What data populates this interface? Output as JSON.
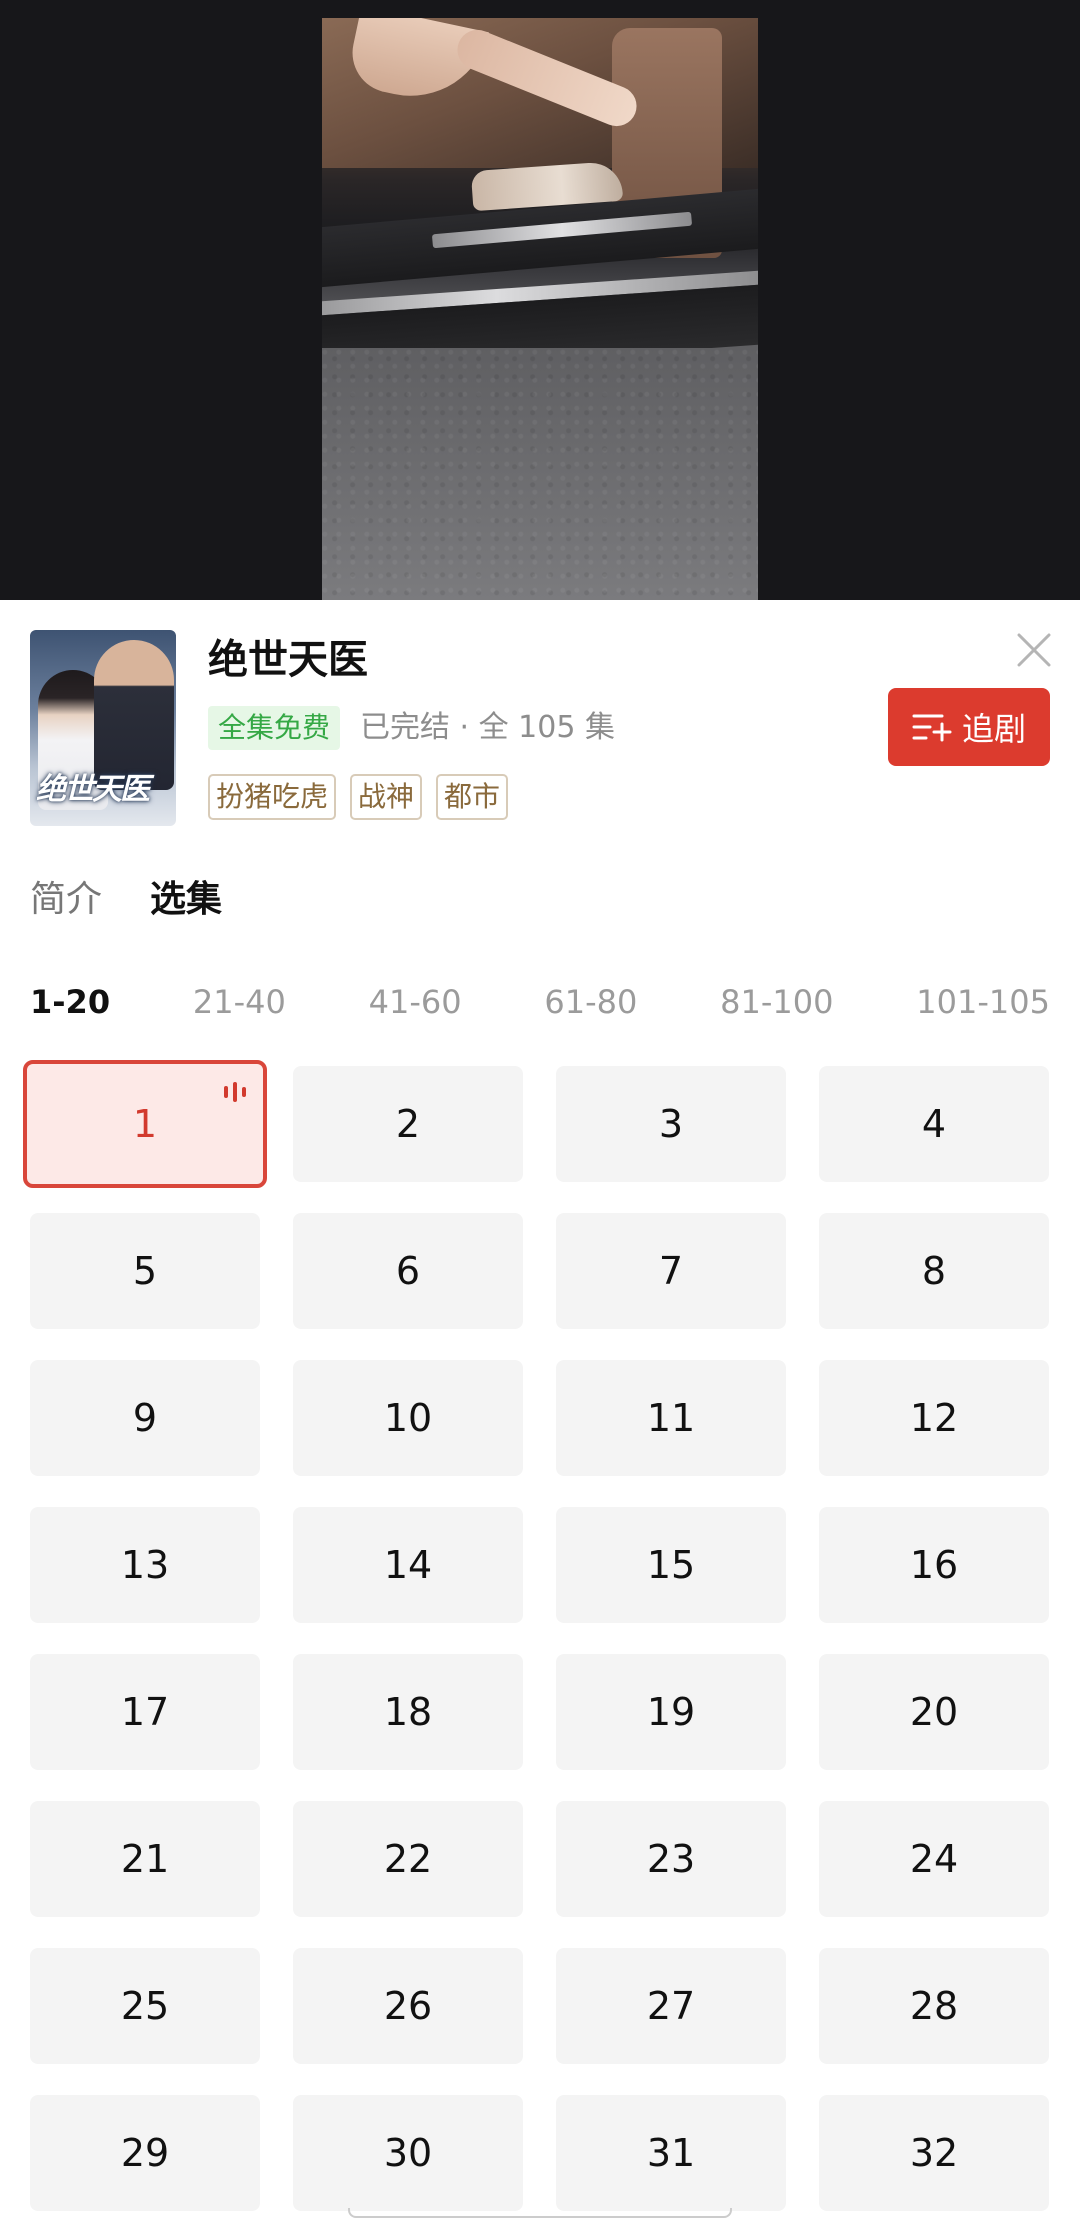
{
  "drama": {
    "poster_text": "绝世天医",
    "title": "绝世天医",
    "free_badge": "全集免费",
    "status": "已完结 · 全 105 集",
    "tags": [
      "扮猪吃虎",
      "战神",
      "都市"
    ],
    "follow_label": "追剧"
  },
  "section_tabs": [
    {
      "label": "简介",
      "active": false
    },
    {
      "label": "选集",
      "active": true
    }
  ],
  "range_tabs": [
    {
      "label": "1-20",
      "active": true
    },
    {
      "label": "21-40",
      "active": false
    },
    {
      "label": "41-60",
      "active": false
    },
    {
      "label": "61-80",
      "active": false
    },
    {
      "label": "81-100",
      "active": false
    },
    {
      "label": "101-105",
      "active": false
    }
  ],
  "episodes": [
    "1",
    "2",
    "3",
    "4",
    "5",
    "6",
    "7",
    "8",
    "9",
    "10",
    "11",
    "12",
    "13",
    "14",
    "15",
    "16",
    "17",
    "18",
    "19",
    "20",
    "21",
    "22",
    "23",
    "24",
    "25",
    "26",
    "27",
    "28",
    "29",
    "30",
    "31",
    "32"
  ],
  "current_episode": "1",
  "colors": {
    "accent": "#dc3b2e",
    "free_green": "#35a845",
    "tag_brown": "#8a6a3c"
  },
  "icons": {
    "close": "close-icon",
    "follow": "add-to-list-icon",
    "playing": "playing-bars-icon"
  }
}
